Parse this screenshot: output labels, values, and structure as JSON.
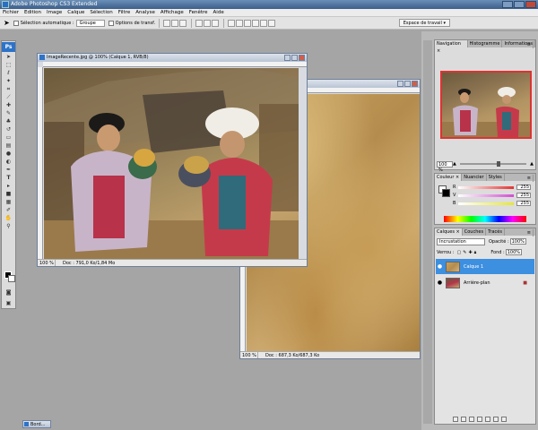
{
  "app": {
    "title": "Adobe Photoshop CS3 Extended"
  },
  "menu": [
    "Fichier",
    "Edition",
    "Image",
    "Calque",
    "Sélection",
    "Filtre",
    "Analyse",
    "Affichage",
    "Fenêtre",
    "Aide"
  ],
  "options": {
    "auto_select_label": "Sélection automatique :",
    "auto_select_value": "Groupe",
    "transform_label": "Options de transf.",
    "workspace_label": "Espace de travail ▾"
  },
  "toolbox": {
    "logo": "Ps"
  },
  "doc_front": {
    "title": "ImageRecente.jpg @ 100% (Calque 1, RVB/8)",
    "zoom": "100 %",
    "status": "Doc : 791,0 Ko/1,84 Mo"
  },
  "doc_back": {
    "zoom": "100 %",
    "status": "Doc : 687,3 Ko/687,3 Ko"
  },
  "navigator": {
    "tabs": [
      "Navigation ×",
      "Histogramme",
      "Informations"
    ],
    "zoom": "100 %"
  },
  "color": {
    "tabs": [
      "Couleur ×",
      "Nuancier",
      "Styles"
    ],
    "channels": [
      {
        "label": "R",
        "value": "255",
        "color": "#e63333"
      },
      {
        "label": "V",
        "value": "255",
        "color": "#d24fd2"
      },
      {
        "label": "B",
        "value": "255",
        "color": "#e6e633"
      }
    ]
  },
  "layers": {
    "tabs": [
      "Calques ×",
      "Couches",
      "Tracés"
    ],
    "blend_mode": "Incrustation",
    "opacity_label": "Opacité :",
    "opacity_value": "100%",
    "lock_label": "Verrou :",
    "fill_label": "Fond :",
    "fill_value": "100%",
    "items": [
      {
        "name": "Calque 1",
        "selected": true
      },
      {
        "name": "Arrière-plan",
        "selected": false
      }
    ]
  },
  "taskbar": {
    "item": "Bord..."
  },
  "colors": {
    "selected_layer": "#3d8fe0",
    "nav_frame": "#dd3333"
  }
}
